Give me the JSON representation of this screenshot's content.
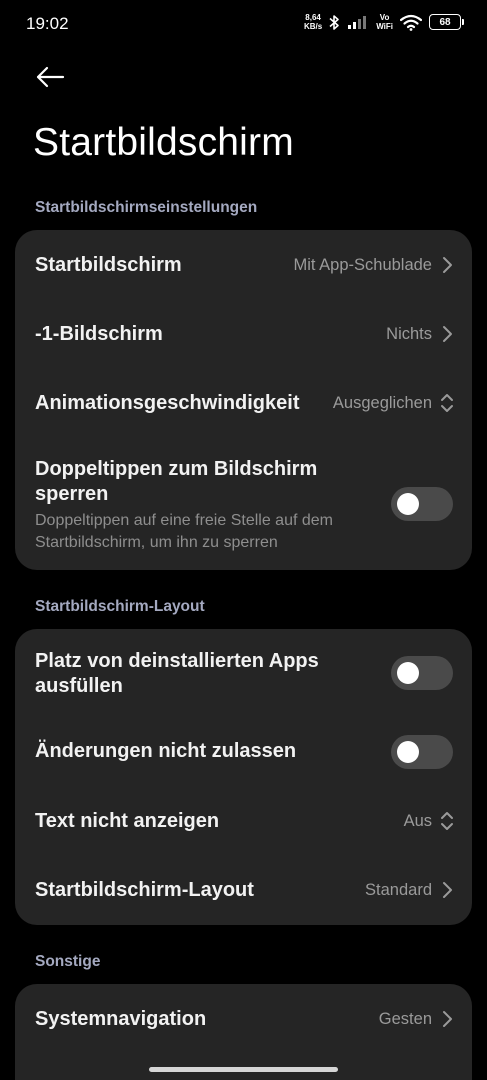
{
  "status_bar": {
    "time": "19:02",
    "net_speed_value": "8,64",
    "net_speed_unit": "KB/s",
    "vo": "Vo",
    "wifi_label": "WiFi",
    "battery": "68"
  },
  "header": {
    "title": "Startbildschirm"
  },
  "sections": {
    "home_settings": {
      "label": "Startbildschirmseinstellungen",
      "startbildschirm": {
        "label": "Startbildschirm",
        "value": "Mit App-Schublade"
      },
      "minus_one": {
        "label": "-1-Bildschirm",
        "value": "Nichts"
      },
      "animation": {
        "label": "Animationsgeschwindigkeit",
        "value": "Ausgeglichen"
      },
      "double_tap": {
        "label_line1": "Doppeltippen zum Bildschirm",
        "label_line2": "sperren",
        "sub_line1": "Doppeltippen auf eine freie Stelle auf dem",
        "sub_line2": "Startbildschirm, um ihn zu sperren",
        "enabled": false
      }
    },
    "layout": {
      "label": "Startbildschirm-Layout",
      "fill_gaps": {
        "label_line1": "Platz von deinstallierten Apps",
        "label_line2": "ausfüllen",
        "enabled": false
      },
      "lock_layout": {
        "label": "Änderungen nicht zulassen",
        "enabled": false
      },
      "hide_text": {
        "label": "Text nicht anzeigen",
        "value": "Aus"
      },
      "layout_item": {
        "label": "Startbildschirm-Layout",
        "value": "Standard"
      }
    },
    "other": {
      "label": "Sonstige",
      "system_nav": {
        "label": "Systemnavigation",
        "value": "Gesten"
      }
    }
  },
  "colors": {
    "background": "#000000",
    "card": "#252525",
    "section_label": "#a4a9c0",
    "secondary_text": "#9a9a9a",
    "toggle_off": "#4a4a4a"
  }
}
